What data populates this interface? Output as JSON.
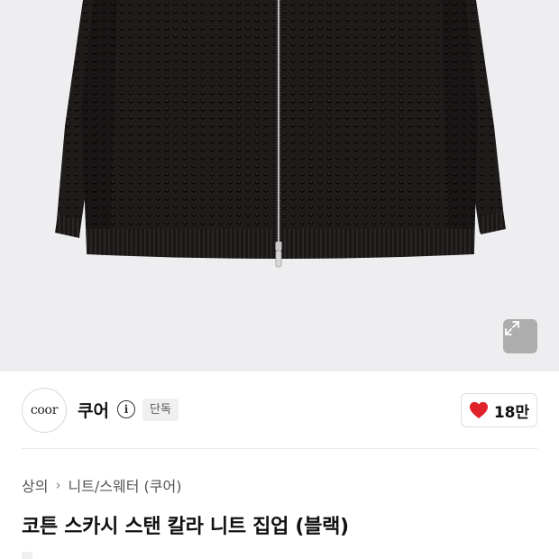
{
  "product_image": {
    "alt": "코튼 스카시 스탠 칼라 니트 집업 (블랙)",
    "expand_label": "확대"
  },
  "brand": {
    "logo_text": "coor",
    "name": "쿠어",
    "badge": "단독"
  },
  "likes": {
    "count": "18만",
    "heart_color": "#e0222b"
  },
  "breadcrumb": {
    "items": [
      "상의",
      "니트/스웨터 (쿠어)"
    ],
    "separator": "›"
  },
  "product": {
    "title": "코튼 스카시 스탠 칼라 니트 집업 (블랙)",
    "tag": ""
  }
}
